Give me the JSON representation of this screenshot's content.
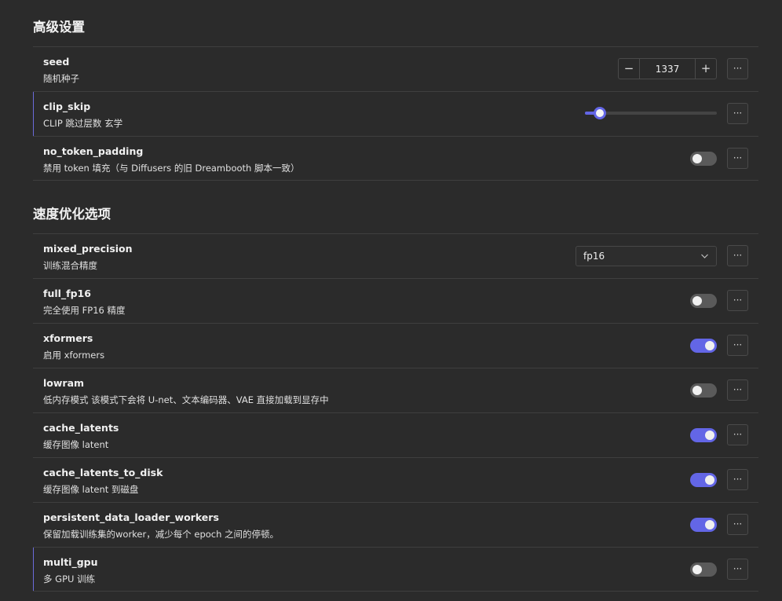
{
  "sections": [
    {
      "title": "高级设置",
      "rows": [
        {
          "name": "seed",
          "desc": "随机种子",
          "control": "stepper",
          "value": "1337",
          "minus": "−",
          "plus": "+"
        },
        {
          "name": "clip_skip",
          "desc": "CLIP 跳过层数 玄学",
          "control": "slider",
          "level": 0.08,
          "accent": true
        },
        {
          "name": "no_token_padding",
          "desc": "禁用 token 填充（与 Diffusers 的旧 Dreambooth 脚本一致）",
          "control": "toggle",
          "on": false
        }
      ]
    },
    {
      "title": "速度优化选项",
      "rows": [
        {
          "name": "mixed_precision",
          "desc": "训练混合精度",
          "control": "select",
          "value": "fp16"
        },
        {
          "name": "full_fp16",
          "desc": "完全使用 FP16 精度",
          "control": "toggle",
          "on": false
        },
        {
          "name": "xformers",
          "desc": "启用 xformers",
          "control": "toggle",
          "on": true
        },
        {
          "name": "lowram",
          "desc": "低内存模式 该模式下会将 U-net、文本编码器、VAE 直接加载到显存中",
          "control": "toggle",
          "on": false
        },
        {
          "name": "cache_latents",
          "desc": "缓存图像 latent",
          "control": "toggle",
          "on": true
        },
        {
          "name": "cache_latents_to_disk",
          "desc": "缓存图像 latent 到磁盘",
          "control": "toggle",
          "on": true
        },
        {
          "name": "persistent_data_loader_workers",
          "desc": "保留加载训练集的worker，减少每个 epoch 之间的停顿。",
          "control": "toggle",
          "on": true
        },
        {
          "name": "multi_gpu",
          "desc": "多 GPU 训练",
          "control": "toggle",
          "on": false,
          "accent": true
        }
      ]
    }
  ],
  "more_label": "···",
  "select_chevron": "chevron-down-icon",
  "colors": {
    "accent": "#6366e6",
    "background": "#2b2b2b",
    "toggle_off": "#5a5a5a"
  }
}
